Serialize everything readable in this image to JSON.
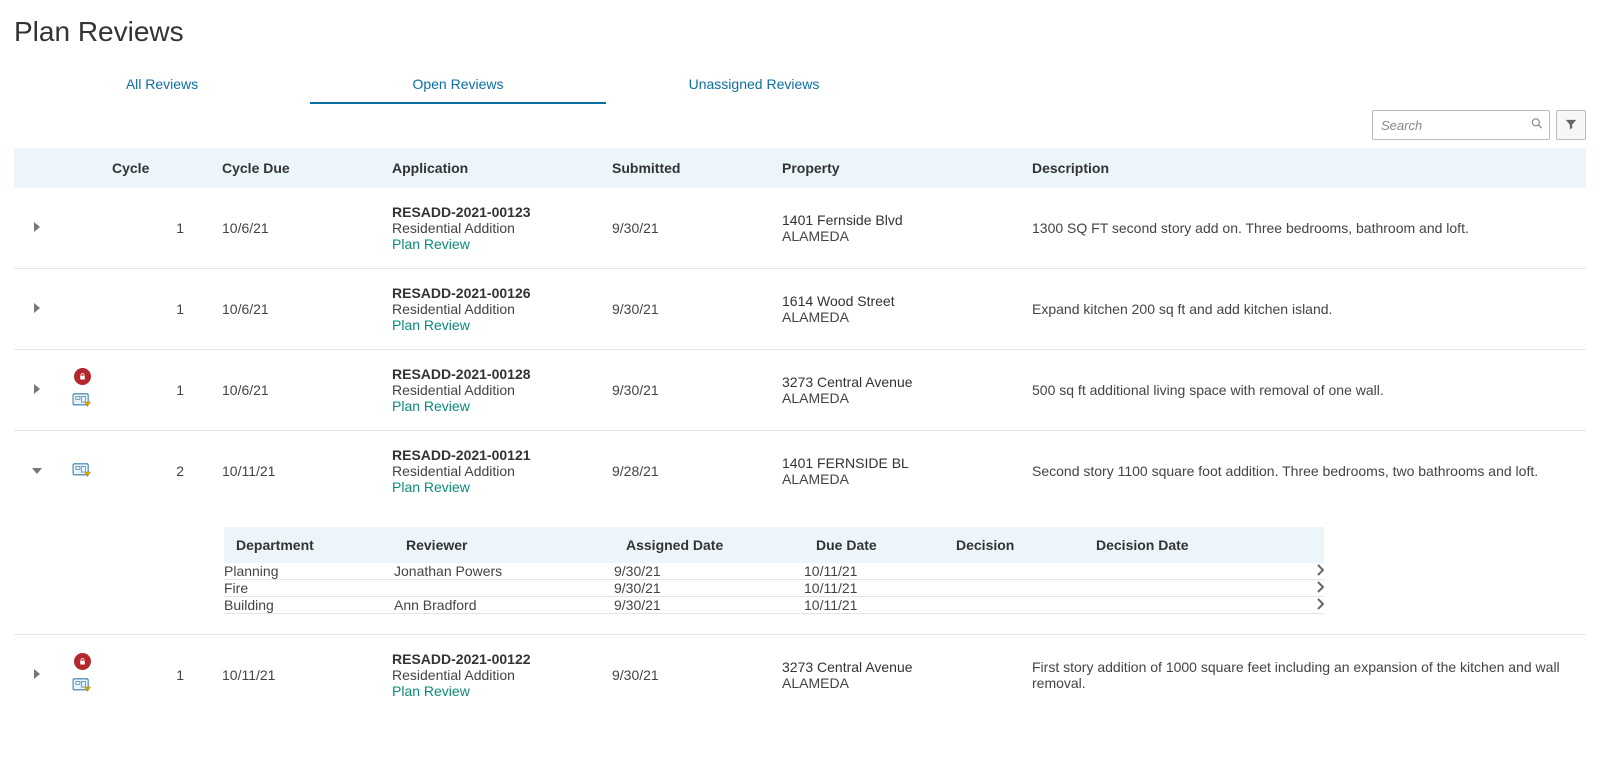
{
  "page_title": "Plan Reviews",
  "tabs": {
    "all": "All Reviews",
    "open": "Open Reviews",
    "unassigned": "Unassigned Reviews"
  },
  "search": {
    "placeholder": "Search"
  },
  "columns": {
    "cycle": "Cycle",
    "cycle_due": "Cycle Due",
    "application": "Application",
    "submitted": "Submitted",
    "property": "Property",
    "description": "Description"
  },
  "rows": [
    {
      "cycle": "1",
      "cycle_due": "10/6/21",
      "app_number": "RESADD-2021-00123",
      "app_type": "Residential Addition",
      "app_link": "Plan Review",
      "submitted": "9/30/21",
      "prop_addr": "1401 Fernside Blvd",
      "prop_city": "ALAMEDA",
      "description": "1300 SQ FT second story add on. Three bedrooms, bathroom and loft.",
      "has_lock": false,
      "has_plan": false,
      "expanded": false
    },
    {
      "cycle": "1",
      "cycle_due": "10/6/21",
      "app_number": "RESADD-2021-00126",
      "app_type": "Residential Addition",
      "app_link": "Plan Review",
      "submitted": "9/30/21",
      "prop_addr": "1614 Wood Street",
      "prop_city": "ALAMEDA",
      "description": "Expand kitchen 200 sq ft and add kitchen island.",
      "has_lock": false,
      "has_plan": false,
      "expanded": false
    },
    {
      "cycle": "1",
      "cycle_due": "10/6/21",
      "app_number": "RESADD-2021-00128",
      "app_type": "Residential Addition",
      "app_link": "Plan Review",
      "submitted": "9/30/21",
      "prop_addr": "3273 Central Avenue",
      "prop_city": "ALAMEDA",
      "description": "500 sq ft additional living space with removal of one wall.",
      "has_lock": true,
      "has_plan": true,
      "expanded": false
    },
    {
      "cycle": "2",
      "cycle_due": "10/11/21",
      "app_number": "RESADD-2021-00121",
      "app_type": "Residential Addition",
      "app_link": "Plan Review",
      "submitted": "9/28/21",
      "prop_addr": "1401 FERNSIDE BL",
      "prop_city": "ALAMEDA",
      "description": "Second story 1100 square foot addition. Three bedrooms, two bathrooms and loft.",
      "has_lock": false,
      "has_plan": true,
      "expanded": true
    },
    {
      "cycle": "1",
      "cycle_due": "10/11/21",
      "app_number": "RESADD-2021-00122",
      "app_type": "Residential Addition",
      "app_link": "Plan Review",
      "submitted": "9/30/21",
      "prop_addr": "3273 Central Avenue",
      "prop_city": "ALAMEDA",
      "description": "First story addition of 1000 square feet including an expansion of the kitchen and wall removal.",
      "has_lock": true,
      "has_plan": true,
      "expanded": false
    }
  ],
  "detail_columns": {
    "department": "Department",
    "reviewer": "Reviewer",
    "assigned_date": "Assigned Date",
    "due_date": "Due Date",
    "decision": "Decision",
    "decision_date": "Decision Date"
  },
  "detail_rows": [
    {
      "department": "Planning",
      "reviewer": "Jonathan Powers",
      "assigned_date": "9/30/21",
      "due_date": "10/11/21",
      "decision": "",
      "decision_date": ""
    },
    {
      "department": "Fire",
      "reviewer": "",
      "assigned_date": "9/30/21",
      "due_date": "10/11/21",
      "decision": "",
      "decision_date": ""
    },
    {
      "department": "Building",
      "reviewer": "Ann Bradford",
      "assigned_date": "9/30/21",
      "due_date": "10/11/21",
      "decision": "",
      "decision_date": ""
    }
  ]
}
